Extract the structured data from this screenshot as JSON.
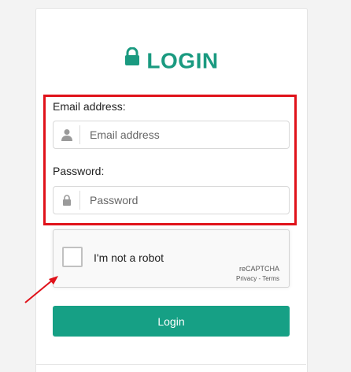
{
  "login": {
    "title": "LOGIN",
    "email_label": "Email address:",
    "email_placeholder": "Email address",
    "password_label": "Password:",
    "password_placeholder": "Password",
    "recaptcha": {
      "label": "I'm not a robot",
      "brand": "reCAPTCHA",
      "links": "Privacy - Terms"
    },
    "submit_label": "Login"
  },
  "colors": {
    "accent": "#16a085",
    "highlight_border": "#e0121a",
    "arrow": "#e0121a"
  },
  "icons": {
    "title": "lock-icon",
    "email": "user-icon",
    "password": "lock-icon",
    "annotation": "arrow-icon"
  }
}
